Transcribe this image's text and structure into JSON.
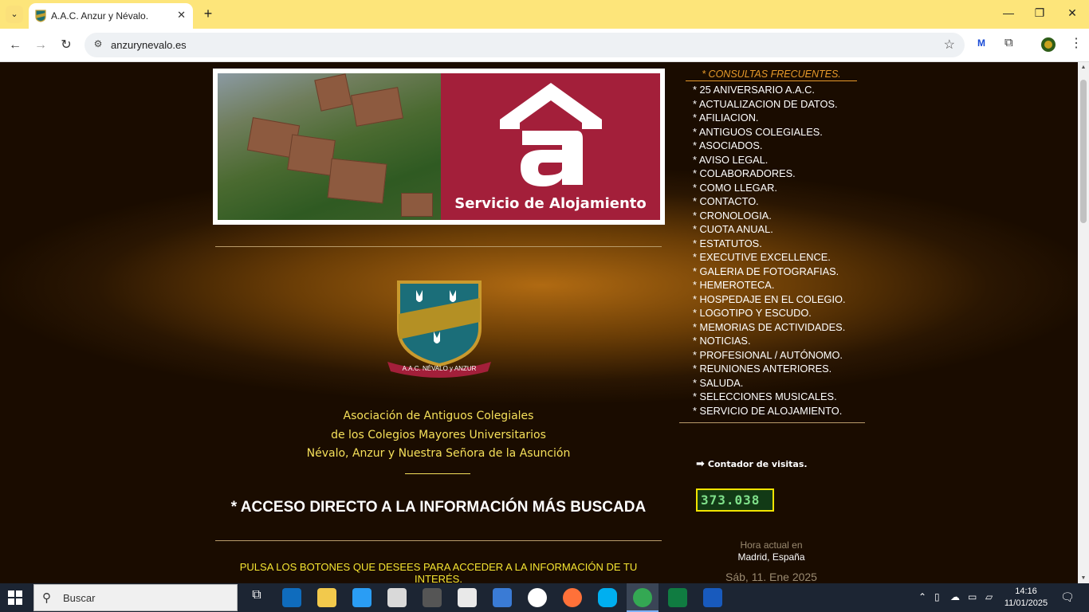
{
  "browser": {
    "tab_title": "A.A.C. Anzur y Névalo.",
    "url": "anzurynevalo.es"
  },
  "banner": {
    "label": "Servicio de Alojamiento"
  },
  "crest": {
    "ribbon_text": "A.A.C. NÉVALO y ANZUR"
  },
  "association": {
    "line1": "Asociación de Antiguos Colegiales",
    "line2": "de los Colegios Mayores Universitarios",
    "line3": "Névalo, Anzur y Nuestra Señora de la Asunción"
  },
  "main": {
    "direct_access_title": "* ACCESO DIRECTO A LA INFORMACIÓN MÁS BUSCADA",
    "press_text": "PULSA LOS BOTONES QUE DESEES PARA ACCEDER A LA INFORMACIÓN DE TU INTERÉS."
  },
  "faq": {
    "heading": "* CONSULTAS FRECUENTES.",
    "items": [
      "* 25 ANIVERSARIO A.A.C.",
      "* ACTUALIZACION DE DATOS.",
      "* AFILIACION.",
      "* ANTIGUOS COLEGIALES.",
      "* ASOCIADOS.",
      "* AVISO LEGAL.",
      "* COLABORADORES.",
      "* COMO LLEGAR.",
      "* CONTACTO.",
      "* CRONOLOGIA.",
      "* CUOTA ANUAL.",
      "* ESTATUTOS.",
      "* EXECUTIVE EXCELLENCE.",
      "* GALERIA DE FOTOGRAFIAS.",
      "* HEMEROTECA.",
      "* HOSPEDAJE EN EL COLEGIO.",
      "* LOGOTIPO Y ESCUDO.",
      "* MEMORIAS DE ACTIVIDADES.",
      "* NOTICIAS.",
      "* PROFESIONAL / AUTÓNOMO.",
      "* REUNIONES ANTERIORES.",
      "* SALUDA.",
      "* SELECCIONES MUSICALES.",
      "* SERVICIO DE ALOJAMIENTO."
    ]
  },
  "counter": {
    "label": "Contador de visitas.",
    "value": "373.038"
  },
  "clock": {
    "label": "Hora actual en",
    "city": "Madrid, España",
    "date": "Sáb, 11. Ene 2025"
  },
  "taskbar": {
    "search_placeholder": "Buscar",
    "time": "14:16",
    "date": "11/01/2025"
  },
  "colors": {
    "accent_red": "#a31f3a",
    "text_yellow": "#f5e05a",
    "faq_orange": "#e79a2a",
    "counter_border": "#f1e400"
  },
  "icons": [
    "chevron-down-icon",
    "close-icon",
    "plus-icon",
    "minimize-icon",
    "maximize-icon",
    "back-icon",
    "forward-icon",
    "reload-icon",
    "site-info-icon",
    "star-icon",
    "extensions-icon",
    "profile-icon",
    "menu-icon",
    "windows-start-icon",
    "search-icon",
    "arrow-right-icon"
  ]
}
